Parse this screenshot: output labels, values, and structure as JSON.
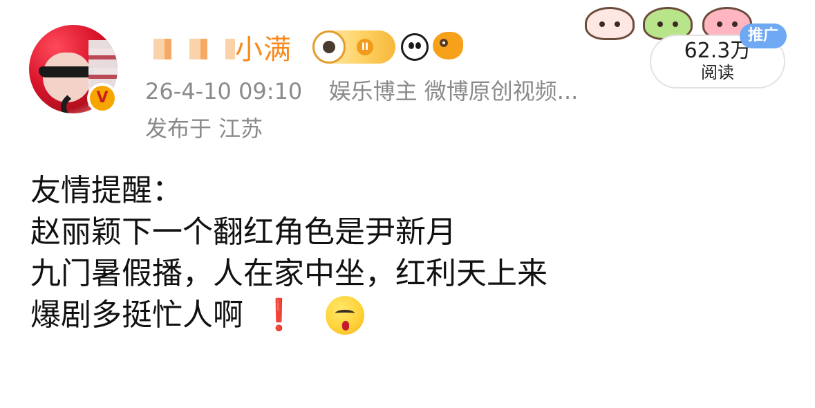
{
  "post": {
    "author": {
      "display_name_visible_suffix": "小满",
      "badges": [
        "astronaut-badge",
        "panda-badge",
        "fish-badge"
      ],
      "verified_badge_letter": "V"
    },
    "meta": {
      "time": "26-4-10 09:10",
      "tags": "娱乐博主 微博原创视频...",
      "location": "发布于 江苏"
    },
    "stats": {
      "reads_value": "62.3万",
      "reads_label": "阅读"
    },
    "promo_label": "推广",
    "content_lines": [
      "友情提醒：",
      "赵丽颖下一个翻红角色是尹新月",
      "九门暑假播，人在家中坐，红利天上来",
      "爆剧多挺忙人啊"
    ],
    "content_emojis": [
      "❗",
      "yummy-face"
    ]
  },
  "colors": {
    "username": "#f88a1c",
    "meta_text": "#8a8a8a",
    "promo_bg": "#6fa8f3",
    "emoji_red": "#e11d2e"
  }
}
